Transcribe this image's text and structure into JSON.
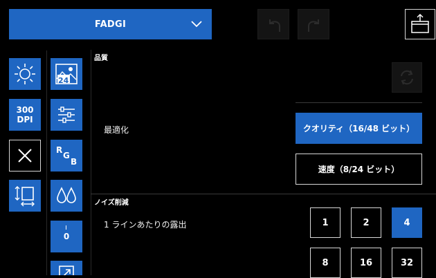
{
  "toolbar": {
    "preset_label": "FADGI",
    "icons": {
      "dropdown": "chevron-down-icon",
      "undo": "undo-icon",
      "redo": "redo-icon",
      "export": "export-icon"
    }
  },
  "tools_left": {
    "brightness_icon": "sun-icon",
    "dpi_line1": "300",
    "dpi_line2": "DPI",
    "clear_icon": "close-icon",
    "resize_icon": "resize-icon"
  },
  "tools_right": {
    "image_depth_label": "24",
    "adjust_icon": "sliders-icon",
    "rgb_r": "R",
    "rgb_g": "G",
    "rgb_b": "B",
    "drops_icon": "drops-icon",
    "offset_label": "0",
    "crop_icon": "crop-icon"
  },
  "quality": {
    "title": "品質",
    "optimize_label": "最適化",
    "quality_option": "クオリティ（16/48 ビット）",
    "speed_option": "速度（8/24 ビット）",
    "selected": "quality",
    "refresh_icon": "refresh-icon"
  },
  "noise": {
    "title": "ノイズ削減",
    "exposure_label": "1 ラインあたりの露出",
    "options": [
      "1",
      "2",
      "4",
      "8",
      "16",
      "32"
    ],
    "selected": "4"
  },
  "colors": {
    "accent": "#1f66c2",
    "background": "#000000",
    "border": "#d8d8d8",
    "disabled": "#141414"
  }
}
